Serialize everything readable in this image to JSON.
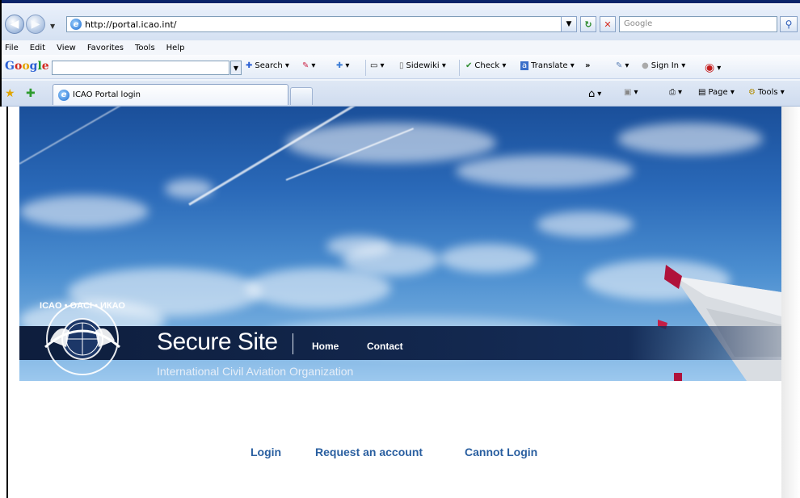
{
  "browser": {
    "address": "http://portal.icao.int/",
    "search_placeholder": "Google",
    "menu": [
      "File",
      "Edit",
      "View",
      "Favorites",
      "Tools",
      "Help"
    ],
    "google_toolbar": {
      "logo": "Google",
      "search_label": "Search",
      "sidewiki_label": "Sidewiki",
      "check_label": "Check",
      "translate_label": "Translate",
      "more_label": "»",
      "signin_label": "Sign In"
    },
    "tab_title": "ICAO Portal login",
    "command_bar": {
      "page_label": "Page",
      "tools_label": "Tools"
    }
  },
  "site": {
    "brand_title": "Secure Site",
    "nav": [
      "Home",
      "Contact"
    ],
    "subtitle": "International Civil Aviation Organization",
    "emblem_text": "ICAO • OACI • ИКАО"
  },
  "links": [
    "Login",
    "Request an account",
    "Cannot Login"
  ],
  "colors": {
    "link": "#2a5fa0",
    "band": "#13284f",
    "sky_top": "#1a4f9a",
    "sky_bottom": "#9cc8ee"
  }
}
